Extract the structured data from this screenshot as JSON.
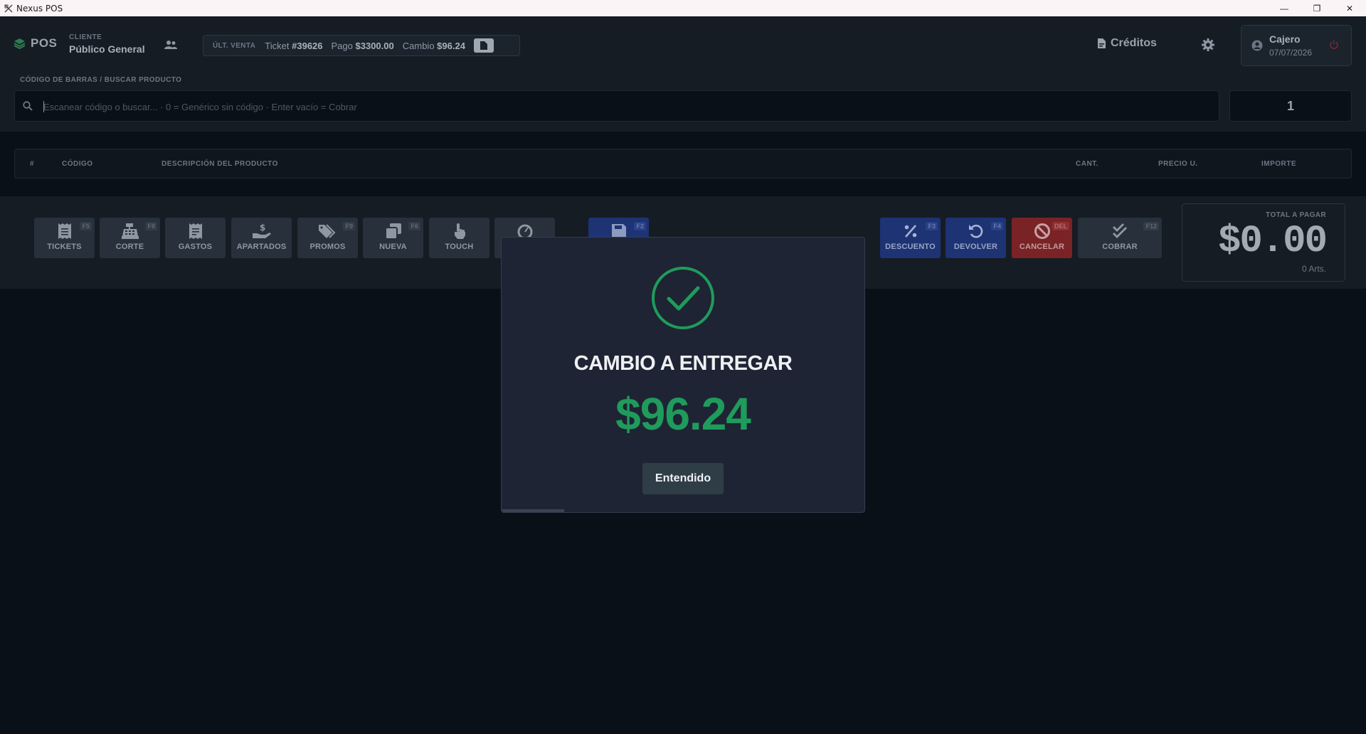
{
  "window": {
    "title": "Nexus POS",
    "minimize_glyph": "—",
    "maximize_glyph": "❐",
    "close_glyph": "✕"
  },
  "header": {
    "logo_text": "POS",
    "client_label": "CLIENTE",
    "client_value": "Público General",
    "last_sale": {
      "tag": "ÚLT. VENTA",
      "ticket_label": "Ticket",
      "ticket_value": "#39626",
      "pago_label": "Pago",
      "pago_value": "$3300.00",
      "cambio_label": "Cambio",
      "cambio_value": "$96.24"
    },
    "creditos_label": "Créditos",
    "cashier_name": "Cajero",
    "cashier_date": "07/07/2026"
  },
  "search": {
    "label": "CÓDIGO DE BARRAS / BUSCAR PRODUCTO",
    "placeholder": "Escanear código o buscar... · 0 = Genérico sin código · Enter vacío = Cobrar",
    "value": "",
    "quantity": "1"
  },
  "table": {
    "columns": [
      "#",
      "CÓDIGO",
      "DESCRIPCIÓN DEL PRODUCTO",
      "CANT.",
      "PRECIO U.",
      "IMPORTE"
    ]
  },
  "actions": {
    "left": [
      {
        "label": "TICKETS",
        "key": "F5",
        "icon": "receipt-icon"
      },
      {
        "label": "CORTE",
        "key": "F8",
        "icon": "cash-register-icon"
      },
      {
        "label": "GASTOS",
        "key": "",
        "icon": "expense-receipt-icon"
      },
      {
        "label": "APARTADOS",
        "key": "",
        "icon": "hand-dollar-icon"
      },
      {
        "label": "PROMOS",
        "key": "F9",
        "icon": "tags-icon"
      },
      {
        "label": "NUEVA",
        "key": "F6",
        "icon": "copy-window-icon"
      },
      {
        "label": "TOUCH",
        "key": "",
        "icon": "hand-pointer-icon"
      }
    ],
    "save_key": "F2",
    "right": [
      {
        "label": "DESCUENTO",
        "key": "F3",
        "icon": "percent-icon"
      },
      {
        "label": "DEVOLVER",
        "key": "F4",
        "icon": "undo-icon"
      },
      {
        "label": "CANCELAR",
        "key": "DEL",
        "icon": "ban-icon"
      },
      {
        "label": "COBRAR",
        "key": "F12",
        "icon": "check-double-icon"
      }
    ]
  },
  "total": {
    "label": "TOTAL A PAGAR",
    "amount": "$0.00",
    "articles": "0 Arts."
  },
  "modal": {
    "title": "CAMBIO A ENTREGAR",
    "amount": "$96.24",
    "button_label": "Entendido"
  },
  "colors": {
    "success": "#1f9b5c",
    "danger": "#7a2327",
    "primary": "#1d3374"
  }
}
